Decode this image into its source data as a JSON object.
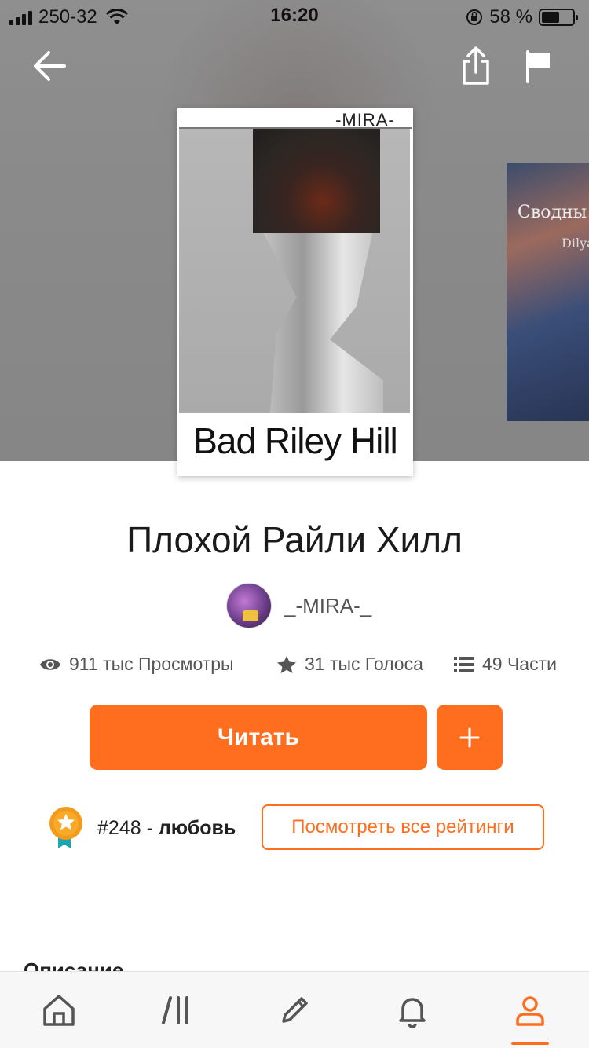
{
  "status_bar": {
    "carrier": "250-32",
    "time": "16:20",
    "battery_percent": "58 %",
    "battery_level": 0.58
  },
  "top_nav": {
    "icons": [
      "back-arrow-icon",
      "share-icon",
      "flag-icon"
    ]
  },
  "cover": {
    "author_text": "_-MIRA-_",
    "title_text": "Bad Riley Hill"
  },
  "next_cover": {
    "title_text": "Сводны",
    "sub_text": "Dilya"
  },
  "book": {
    "title": "Плохой Райли Хилл",
    "author": "_-MIRA-_"
  },
  "stats": {
    "views": "911 тыс Просмотры",
    "votes": "31 тыс Голоса",
    "parts": "49 Части"
  },
  "actions": {
    "read_label": "Читать",
    "add_label": "+"
  },
  "ranking": {
    "number": "#248",
    "separator": " - ",
    "tag": "любовь",
    "view_all_label": "Посмотреть все рейтинги"
  },
  "description": {
    "heading": "Описание"
  },
  "tabbar": {
    "tabs": [
      "home-icon",
      "library-icon",
      "write-icon",
      "notifications-icon",
      "profile-icon"
    ],
    "active_index": 4,
    "accent_color": "#ff6d1f",
    "inactive_color": "#555555"
  },
  "colors": {
    "accent": "#ff6d1f"
  }
}
